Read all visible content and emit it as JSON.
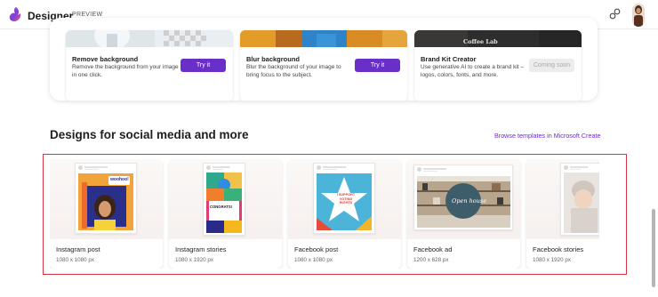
{
  "app": {
    "title": "Designer",
    "badge": "PREVIEW",
    "brand_color": "#7b3fd6",
    "icons": {
      "logo": "designer-logo-icon",
      "share": "share-link-icon",
      "avatar": "user-avatar"
    }
  },
  "features": [
    {
      "title": "Remove background",
      "description": "Remove the background from your image in one click.",
      "button": "Try it",
      "enabled": true
    },
    {
      "title": "Blur background",
      "description": "Blur the background of your image to bring focus to the subject.",
      "button": "Try it",
      "enabled": true
    },
    {
      "title": "Brand Kit Creator",
      "description": "Use generative AI to create a brand kit – logos, colors, fonts, and more.",
      "button": "Coming soon",
      "enabled": false,
      "thumb_text": "Coffee Lab"
    }
  ],
  "social": {
    "title": "Designs for social media and more",
    "browse_link": "Browse templates in Microsoft Create",
    "highlight_color": "#d63343",
    "templates": [
      {
        "name": "Instagram post",
        "size": "1080 x 1080 px",
        "art_text": "woohoo!"
      },
      {
        "name": "Instagram stories",
        "size": "1080 x 1920 px",
        "art_text": "CONGRATS!"
      },
      {
        "name": "Facebook post",
        "size": "1080 x 1080 px",
        "art_text": "I SUPPORT VOTING RIGHTS"
      },
      {
        "name": "Facebook ad",
        "size": "1200 x 628 px",
        "art_text": "Open house"
      },
      {
        "name": "Facebook stories",
        "size": "1080 x 1920 px"
      }
    ]
  },
  "accent_color": "#6b2fc9"
}
